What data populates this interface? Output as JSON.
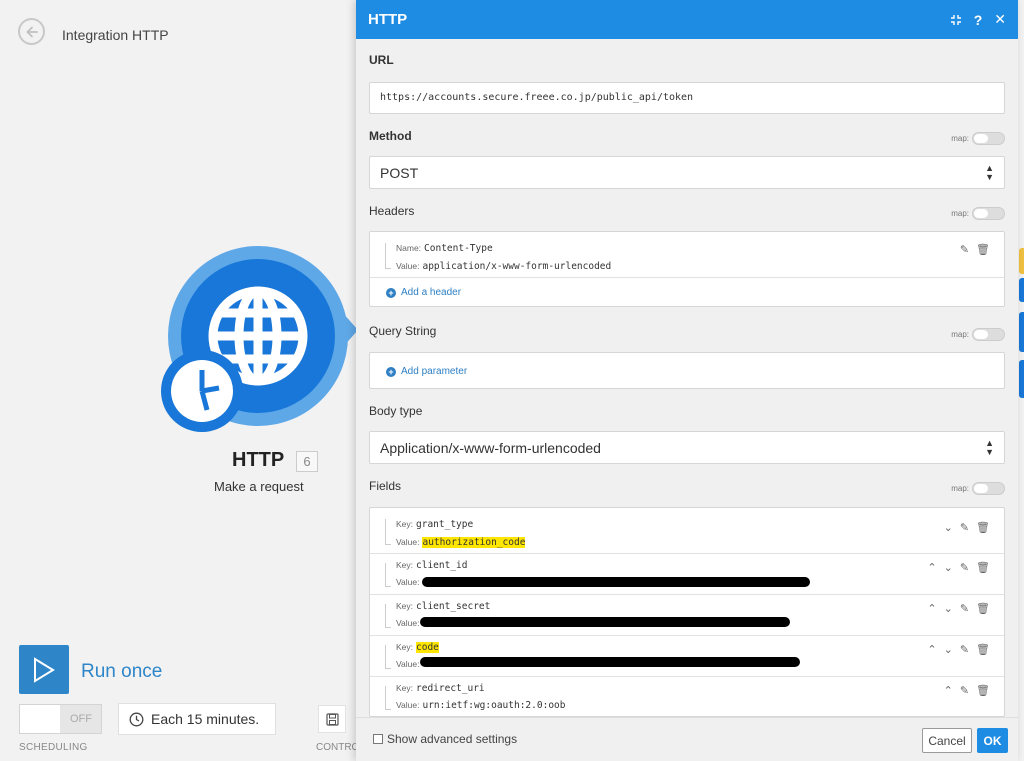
{
  "scenario": {
    "title": "Integration HTTP"
  },
  "module": {
    "name": "HTTP",
    "id": "6",
    "action": "Make a request"
  },
  "run": {
    "label": "Run once"
  },
  "scheduling": {
    "toggle_text": "OFF",
    "interval": "Each 15 minutes.",
    "label": "SCHEDULING"
  },
  "controls": {
    "label": "CONTRO"
  },
  "panel": {
    "title": "HTTP",
    "map_label": "map:",
    "url": {
      "label": "URL",
      "value": "https://accounts.secure.freee.co.jp/public_api/token"
    },
    "method": {
      "label": "Method",
      "value": "POST"
    },
    "headers": {
      "label": "Headers",
      "items": [
        {
          "name_label": "Name:",
          "name": "Content-Type",
          "value_label": "Value:",
          "value": "application/x-www-form-urlencoded"
        }
      ],
      "add_label": "Add a header"
    },
    "query": {
      "label": "Query String",
      "add_label": "Add parameter"
    },
    "body_type": {
      "label": "Body type",
      "value": "Application/x-www-form-urlencoded"
    },
    "fields": {
      "label": "Fields",
      "key_label": "Key:",
      "value_label": "Value:",
      "items": [
        {
          "key": "grant_type",
          "value": "authorization_code"
        },
        {
          "key": "client_id",
          "value": ""
        },
        {
          "key": "client_secret",
          "value": ""
        },
        {
          "key": "code",
          "value": ""
        },
        {
          "key": "redirect_uri",
          "value": "urn:ietf:wg:oauth:2.0:oob"
        }
      ]
    },
    "footer": {
      "advanced": "Show advanced settings",
      "cancel": "Cancel",
      "ok": "OK"
    }
  },
  "colors": {
    "accent": "#1f8ce3",
    "module_blue": "#1877d8",
    "highlight": "#ffe600"
  },
  "icons": [
    "back-arrow-icon",
    "globe-icon",
    "clock-icon",
    "play-icon",
    "save-icon",
    "collapse-icon",
    "help-icon",
    "close-icon",
    "edit-icon",
    "delete-icon",
    "chevron-up-icon",
    "chevron-down-icon",
    "plus-circle-icon"
  ]
}
